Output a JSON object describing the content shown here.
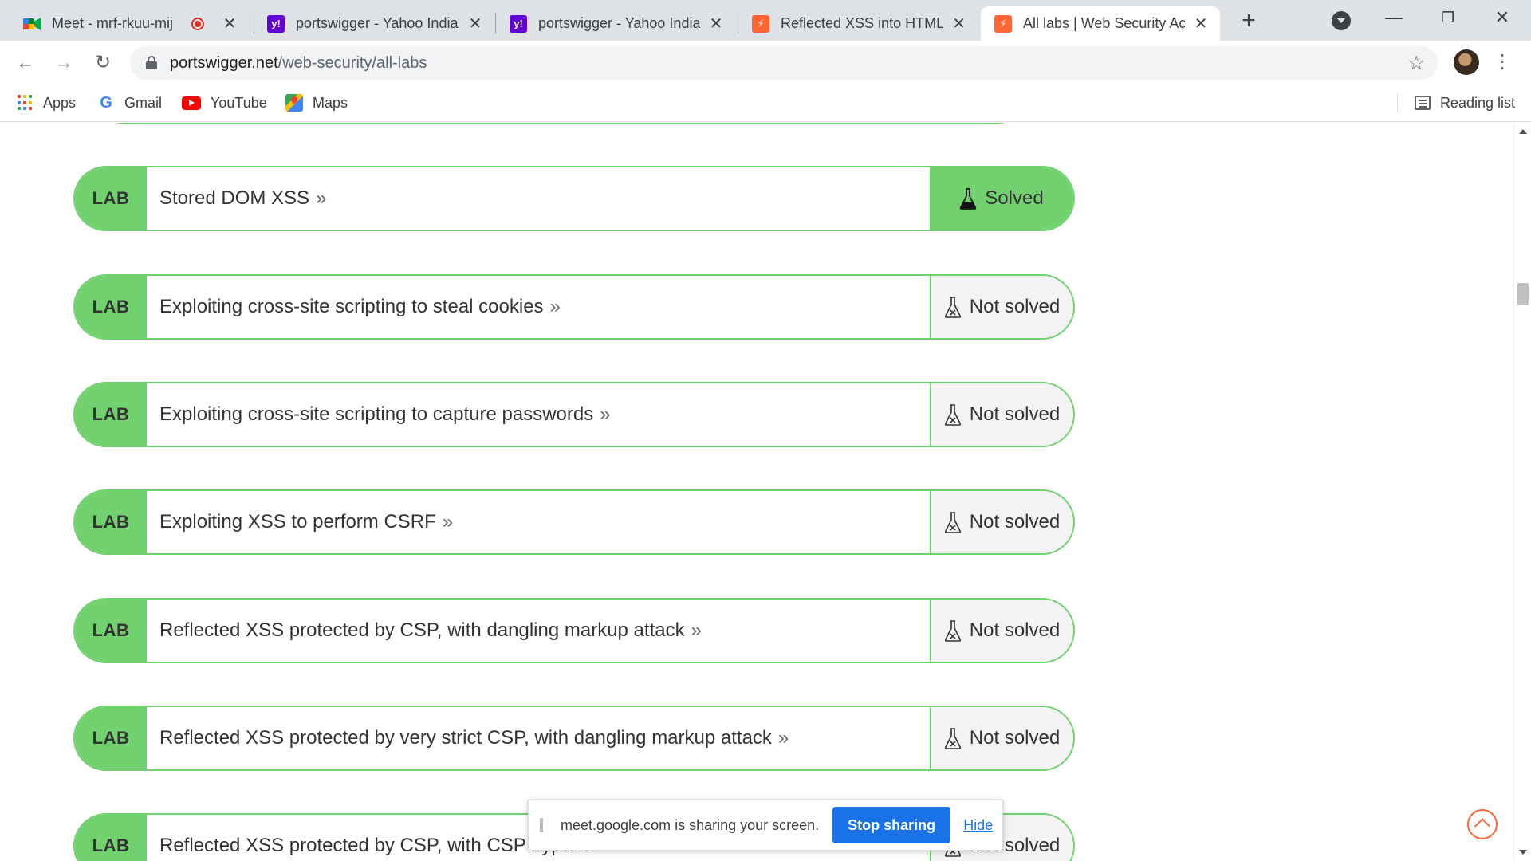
{
  "tabs": [
    {
      "title": "Meet - mrf-rkuu-mij",
      "favicon": "google-meet-icon",
      "recording": true,
      "active": false
    },
    {
      "title": "portswigger - Yahoo India",
      "favicon": "yahoo-icon",
      "active": false
    },
    {
      "title": "portswigger - Yahoo India",
      "favicon": "yahoo-icon",
      "active": false
    },
    {
      "title": "Reflected XSS into HTML c",
      "favicon": "portswigger-icon",
      "active": false
    },
    {
      "title": "All labs | Web Security Ac",
      "favicon": "portswigger-icon",
      "active": true
    }
  ],
  "new_tab_label": "+",
  "address_bar": {
    "host": "portswigger.net",
    "path": "/web-security/all-labs"
  },
  "bookmarks": [
    {
      "label": "Apps",
      "icon": "apps-grid-icon"
    },
    {
      "label": "Gmail",
      "icon": "google-icon"
    },
    {
      "label": "YouTube",
      "icon": "youtube-icon"
    },
    {
      "label": "Maps",
      "icon": "maps-icon"
    }
  ],
  "reading_list_label": "Reading list",
  "labs": [
    {
      "badge": "LAB",
      "title": "Stored DOM XSS",
      "status": "Solved",
      "solved": true
    },
    {
      "badge": "LAB",
      "title": "Exploiting cross-site scripting to steal cookies",
      "status": "Not solved",
      "solved": false
    },
    {
      "badge": "LAB",
      "title": "Exploiting cross-site scripting to capture passwords",
      "status": "Not solved",
      "solved": false
    },
    {
      "badge": "LAB",
      "title": "Exploiting XSS to perform CSRF",
      "status": "Not solved",
      "solved": false
    },
    {
      "badge": "LAB",
      "title": "Reflected XSS protected by CSP, with dangling markup attack",
      "status": "Not solved",
      "solved": false
    },
    {
      "badge": "LAB",
      "title": "Reflected XSS protected by very strict CSP, with dangling markup attack",
      "status": "Not solved",
      "solved": false
    },
    {
      "badge": "LAB",
      "title": "Reflected XSS protected by CSP, with CSP bypass",
      "status": "Not solved",
      "solved": false
    }
  ],
  "share_bar": {
    "message": "meet.google.com is sharing your screen.",
    "stop_label": "Stop sharing",
    "hide_label": "Hide"
  },
  "colors": {
    "lab_green": "#70d16e",
    "tab_strip": "#dee1e6",
    "accent_blue": "#1a73e8",
    "scroll_top_orange": "#ff6633"
  }
}
